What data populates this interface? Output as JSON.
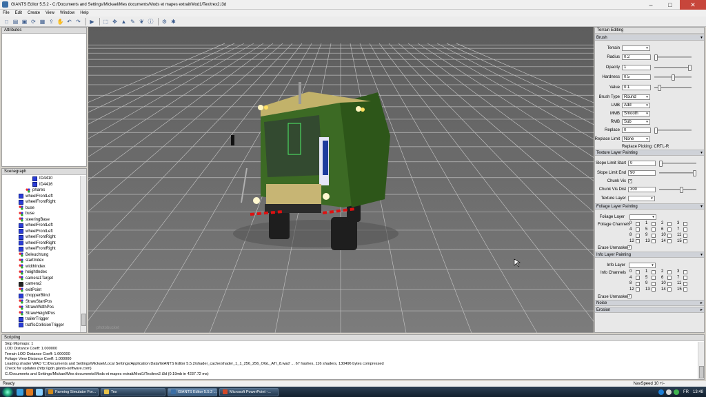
{
  "window": {
    "title": "GIANTS Editor 5.5.2 - C:/Documents and Settings/Mickael/Mes documents/Mods et mapes extrait/Mod1/Tex/trex2.i3d",
    "minimize": "–",
    "maximize": "□",
    "close": "✕"
  },
  "menu": [
    "File",
    "Edit",
    "Create",
    "View",
    "Window",
    "Help"
  ],
  "toolbar": {
    "icons": [
      "new-file-icon",
      "open-folder-icon",
      "save-icon",
      "reload-icon",
      "save-as-icon",
      "export-icon",
      "hand-icon",
      "undo-icon",
      "redo-icon",
      "separator",
      "play-icon",
      "separator",
      "select-icon",
      "translate-icon",
      "terrain-icon",
      "paint-icon",
      "foliage-icon",
      "info-layer-icon",
      "separator",
      "settings-icon",
      "help-icon"
    ],
    "glyphs": [
      "□",
      "▤",
      "▣",
      "⟳",
      "▦",
      "⇪",
      "✋",
      "↶",
      "↷",
      "",
      "▶",
      "",
      "⬚",
      "✥",
      "▲",
      "✎",
      "❦",
      "ⓘ",
      "",
      "⚙",
      "✱"
    ]
  },
  "attributes": {
    "title": "Attributes"
  },
  "scenegraph": {
    "title": "Scenegraph",
    "items": [
      {
        "label": "ID4410",
        "icon": "cube",
        "indent": 44
      },
      {
        "label": "ID4416",
        "icon": "cube",
        "indent": 44
      },
      {
        "label": "phares",
        "icon": "tr",
        "indent": 34
      },
      {
        "label": "wheelFrontLeft",
        "icon": "cube",
        "indent": 24
      },
      {
        "label": "wheelFrontRight",
        "icon": "cube",
        "indent": 24
      },
      {
        "label": "buse",
        "icon": "tr",
        "indent": 24
      },
      {
        "label": "buse",
        "icon": "tr",
        "indent": 24
      },
      {
        "label": "steeringBase",
        "icon": "tr",
        "indent": 24
      },
      {
        "label": "wheelFrontLeft",
        "icon": "cube",
        "indent": 24
      },
      {
        "label": "wheelFrontLeft",
        "icon": "cube",
        "indent": 24
      },
      {
        "label": "wheelFrontRight",
        "icon": "cube",
        "indent": 24
      },
      {
        "label": "wheelFrontRight",
        "icon": "cube",
        "indent": 24
      },
      {
        "label": "wheelFrontRight",
        "icon": "cube",
        "indent": 24
      },
      {
        "label": "Beleuchtung",
        "icon": "tr",
        "indent": 24
      },
      {
        "label": "startIndex",
        "icon": "tr",
        "indent": 24
      },
      {
        "label": "widthIndex",
        "icon": "tr",
        "indent": 24
      },
      {
        "label": "heightIndex",
        "icon": "tr",
        "indent": 24
      },
      {
        "label": "camera1Target",
        "icon": "tr",
        "indent": 24
      },
      {
        "label": "camera2",
        "icon": "cam",
        "indent": 24
      },
      {
        "label": "exitPoint",
        "icon": "tr",
        "indent": 24
      },
      {
        "label": "chopperBlind",
        "icon": "cube",
        "indent": 24
      },
      {
        "label": "StrawStartPos",
        "icon": "tr",
        "indent": 24
      },
      {
        "label": "StrawWidthPos",
        "icon": "tr",
        "indent": 24
      },
      {
        "label": "StrawHeightPos",
        "icon": "tr",
        "indent": 24
      },
      {
        "label": "trailerTrigger",
        "icon": "cube",
        "indent": 24
      },
      {
        "label": "trafficCollisionTrigger",
        "icon": "cube",
        "indent": 24
      }
    ]
  },
  "terrain": {
    "title": "Terrain Editing",
    "brush": {
      "section": "Brush",
      "terrain_label": "Terrain",
      "radius_label": "Radius",
      "radius": "0.2",
      "opacity_label": "Opacity",
      "opacity": "1",
      "hardness_label": "Hardness",
      "hardness": "0.5",
      "value_label": "Value",
      "value": "0.1",
      "brush_type_label": "Brush Type",
      "brush_type": "Round",
      "lmb_label": "LMB",
      "lmb": "Add",
      "mmb_label": "MMB",
      "mmb": "Smooth",
      "rmb_label": "RMB",
      "rmb": "Sub",
      "replace_label": "Replace",
      "replace": "0",
      "replace_limit_label": "Replace Limit",
      "replace_limit": "None",
      "replace_picking": "Replace Picking: CRTL-R"
    },
    "texture": {
      "section": "Texture Layer Painting",
      "slope_start_label": "Slope Limit Start",
      "slope_start": "0",
      "slope_end_label": "Slope Limit End",
      "slope_end": "90",
      "chunk_vis_label": "Chunk Vis",
      "chunk_vis_dist_label": "Chunk Vis Dist",
      "chunk_vis_dist": "300",
      "texture_layer_label": "Texture Layer"
    },
    "foliage": {
      "section": "Foliage Layer Painting",
      "foliage_layer_label": "Foliage Layer",
      "channels_label": "Foliage Channels",
      "erase_label": "Erase Unmasked"
    },
    "info": {
      "section": "Info Layer Painting",
      "info_layer_label": "Info Layer",
      "channels_label": "Info Channels",
      "erase_label": "Erase Unmasked"
    },
    "channels": [
      "0",
      "1",
      "2",
      "3",
      "4",
      "5",
      "6",
      "7",
      "8",
      "9",
      "10",
      "11",
      "12",
      "13",
      "14",
      "15"
    ],
    "noise_section": "Noise",
    "erosion_section": "Erosion"
  },
  "scripting": {
    "title": "Scripting",
    "lines": [
      "Skip Mipmaps: 1",
      "LOD Distance Coeff: 1.000000",
      "Terrain LOD Distance Coeff: 1.000000",
      "Foliage View Distance Coeff: 1.000000",
      "Loading shader WAD 'C:/Documents and Settings/Mickael/Local Settings/Application Data/GIANTS Editor 5.5.2/shader_cache/shader_1_1_256_256_OGL_ATI_8.wad' ... 67 hashes, 116 shaders, 130496 bytes compressed",
      "Check for updates (http://gdn.giants-software.com)",
      "C:/Documents and Settings/Mickael/Mes documents/Mods et mapes extrait/Mod1/Tex/trex2.i3d (0.19mb in 4237.72 ms)"
    ]
  },
  "statusbar": {
    "left": "Ready",
    "right": "NavSpeed 10 +/-"
  },
  "taskbar": {
    "tasks": [
      {
        "label": "Farming Simulator For...",
        "color": "#d08a1a",
        "active": false
      },
      {
        "label": "Tex",
        "color": "#e7c24a",
        "active": false
      },
      {
        "label": "GIANTS Editor 5.5.2 ...",
        "color": "#3a6ea5",
        "active": true
      },
      {
        "label": "Microsoft PowerPoint -...",
        "color": "#d24726",
        "active": false
      }
    ],
    "lang": "FR",
    "clock": "13:48"
  },
  "viewport": {
    "watermark": "photobucket"
  }
}
